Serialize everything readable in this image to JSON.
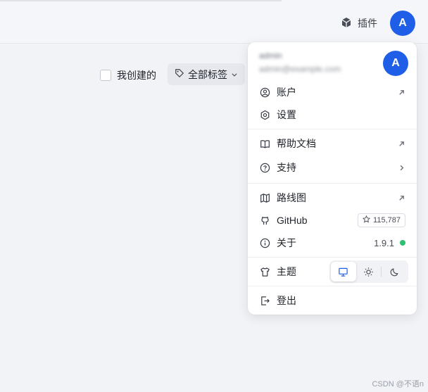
{
  "topbar": {
    "plugins_label": "插件",
    "avatar_letter": "A"
  },
  "filters": {
    "created_by_me_label": "我创建的",
    "tags_label": "全部标签"
  },
  "menu": {
    "user": {
      "name": "admin",
      "email": "admin@example.com",
      "avatar_letter": "A"
    },
    "items": [
      {
        "label": "账户",
        "icon": "user-circle-icon",
        "right": "external-link-icon"
      },
      {
        "label": "设置",
        "icon": "gear-icon",
        "right": ""
      },
      {
        "label": "帮助文档",
        "icon": "book-icon",
        "right": "external-link-icon"
      },
      {
        "label": "支持",
        "icon": "help-circle-icon",
        "right": "chevron-right-icon"
      },
      {
        "label": "路线图",
        "icon": "map-icon",
        "right": "external-link-icon"
      },
      {
        "label": "GitHub",
        "icon": "github-icon",
        "right": "stars-badge"
      },
      {
        "label": "关于",
        "icon": "info-icon",
        "right": "version"
      },
      {
        "label": "主题",
        "icon": "shirt-icon",
        "right": "theme-switcher"
      },
      {
        "label": "登出",
        "icon": "logout-icon",
        "right": ""
      }
    ],
    "github_stars": "115,787",
    "version": "1.9.1",
    "status_color": "#2fbf71",
    "theme_options": [
      "system",
      "light",
      "dark"
    ],
    "theme_selected": "system"
  },
  "colors": {
    "accent": "#1f5fe8"
  },
  "watermark": "CSDN @不语n"
}
